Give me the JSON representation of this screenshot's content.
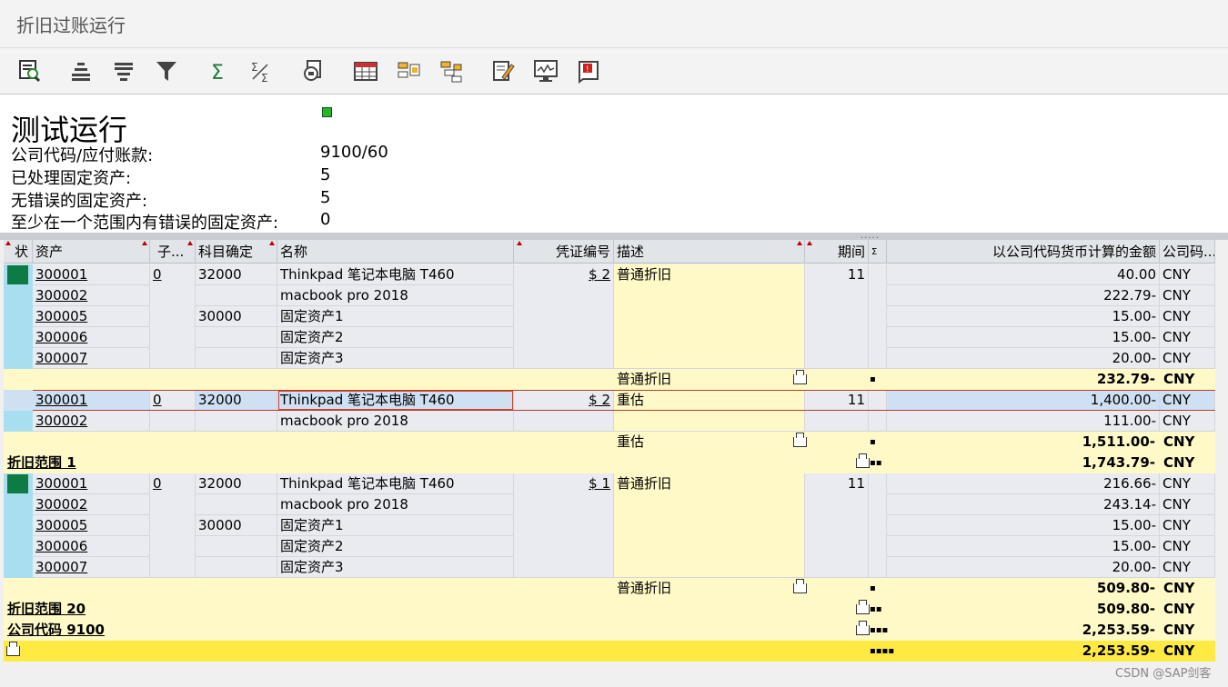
{
  "window": {
    "title": "折旧过账运行"
  },
  "toolbar": {
    "buttons": [
      "detail-icon",
      "sort-ascending-icon",
      "sort-descending-icon",
      "filter-icon",
      "sum-icon",
      "subtotal-icon",
      "print-preview-icon",
      "layout-icon",
      "export-icon",
      "select-layout-icon",
      "abc-analysis-icon",
      "graphic-icon",
      "views-icon"
    ]
  },
  "header": {
    "title": "测试运行",
    "rows": [
      {
        "label": "公司代码/应付账款:",
        "value": "9100/60"
      },
      {
        "label": "已处理固定资产:",
        "value": "5"
      },
      {
        "label": "无错误的固定资产:",
        "value": "5"
      },
      {
        "label": "至少在一个范围内有错误的固定资产:",
        "value": "0"
      }
    ],
    "status_color": "#28b428"
  },
  "columns": {
    "status": "状",
    "asset": "资产",
    "sub": "子...",
    "account": "科目确定",
    "name": "名称",
    "doc": "凭证编号",
    "desc": "描述",
    "period": "期间",
    "sigma": "Σ",
    "amount": "以公司代码货币计算的金额",
    "currency": "公司码..."
  },
  "groups": [
    {
      "doc_no": "$ 2",
      "desc": "普通折旧",
      "period": "11",
      "sub": "0",
      "rows": [
        {
          "asset": "300001",
          "account": "32000",
          "name": "Thinkpad 笔记本电脑 T460",
          "amount": "40.00",
          "currency": "CNY"
        },
        {
          "asset": "300002",
          "account": "",
          "name": "macbook pro 2018",
          "amount": "222.79-",
          "currency": "CNY"
        },
        {
          "asset": "300005",
          "account": "30000",
          "name": "固定资产1",
          "amount": "15.00-",
          "currency": "CNY"
        },
        {
          "asset": "300006",
          "account": "",
          "name": "固定资产2",
          "amount": "15.00-",
          "currency": "CNY"
        },
        {
          "asset": "300007",
          "account": "",
          "name": "固定资产3",
          "amount": "20.00-",
          "currency": "CNY"
        }
      ],
      "subtotal": {
        "label": "普通折旧",
        "dots": "▪",
        "amount": "232.79-",
        "currency": "CNY"
      }
    },
    {
      "doc_no": "$ 2",
      "desc": "重估",
      "period": "11",
      "sub": "0",
      "rows": [
        {
          "asset": "300001",
          "account": "32000",
          "name": "Thinkpad 笔记本电脑 T460",
          "amount": "1,400.00-",
          "currency": "CNY"
        },
        {
          "asset": "300002",
          "account": "",
          "name": "macbook pro 2018",
          "amount": "111.00-",
          "currency": "CNY"
        }
      ],
      "subtotal": {
        "label": "重估",
        "dots": "▪",
        "amount": "1,511.00-",
        "currency": "CNY"
      }
    },
    {
      "doc_no": "$ 1",
      "desc": "普通折旧",
      "period": "11",
      "sub": "0",
      "rows": [
        {
          "asset": "300001",
          "account": "32000",
          "name": "Thinkpad 笔记本电脑 T460",
          "amount": "216.66-",
          "currency": "CNY"
        },
        {
          "asset": "300002",
          "account": "",
          "name": "macbook pro 2018",
          "amount": "243.14-",
          "currency": "CNY"
        },
        {
          "asset": "300005",
          "account": "30000",
          "name": "固定资产1",
          "amount": "15.00-",
          "currency": "CNY"
        },
        {
          "asset": "300006",
          "account": "",
          "name": "固定资产2",
          "amount": "15.00-",
          "currency": "CNY"
        },
        {
          "asset": "300007",
          "account": "",
          "name": "固定资产3",
          "amount": "20.00-",
          "currency": "CNY"
        }
      ],
      "subtotal": {
        "label": "普通折旧",
        "dots": "▪",
        "amount": "509.80-",
        "currency": "CNY"
      }
    }
  ],
  "totals": {
    "range1": {
      "label": "折旧范围  1",
      "dots": "▪▪",
      "amount": "1,743.79-",
      "currency": "CNY"
    },
    "range20": {
      "label": "折旧范围 20",
      "dots": "▪▪",
      "amount": "509.80-",
      "currency": "CNY"
    },
    "company": {
      "label": "公司代码 9100",
      "dots": "▪▪▪",
      "amount": "2,253.59-",
      "currency": "CNY"
    },
    "grand": {
      "dots": "▪▪▪▪",
      "amount": "2,253.59-",
      "currency": "CNY"
    }
  },
  "watermark": "CSDN @SAP剑客"
}
